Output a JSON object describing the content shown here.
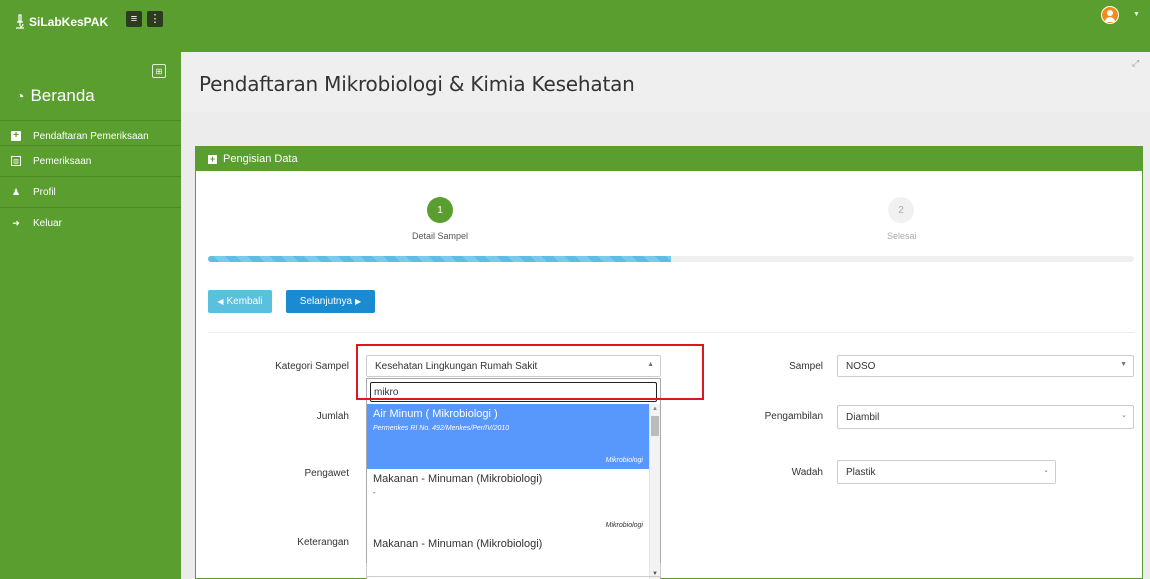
{
  "app": {
    "brand": "SiLabKesPAK"
  },
  "sidebar": {
    "home": "Beranda",
    "items": [
      {
        "label": "Pendaftaran Pemeriksaan",
        "icon": "plus-square-icon"
      },
      {
        "label": "Pemeriksaan",
        "icon": "grid-icon"
      },
      {
        "label": "Profil",
        "icon": "user-icon"
      },
      {
        "label": "Keluar",
        "icon": "sign-out-icon"
      }
    ]
  },
  "page": {
    "title": "Pendaftaran Mikrobiologi & Kimia Kesehatan"
  },
  "panel": {
    "title": "Pengisian Data"
  },
  "steps": [
    {
      "number": "1",
      "label": "Detail Sampel",
      "active": true
    },
    {
      "number": "2",
      "label": "Selesai",
      "active": false
    }
  ],
  "progress": {
    "fraction": 0.5
  },
  "buttons": {
    "back": "Kembali",
    "next": "Selanjutnya"
  },
  "form": {
    "kategori_label": "Kategori Sampel",
    "kategori_value": "Kesehatan Lingkungan Rumah Sakit",
    "jumlah_label": "Jumlah",
    "pengawet_label": "Pengawet",
    "keterangan_label": "Keterangan",
    "sampel_label": "Sampel",
    "sampel_value": "NOSO",
    "pengambilan_label": "Pengambilan",
    "pengambilan_value": "Diambil",
    "wadah_label": "Wadah",
    "wadah_value": "Plastik"
  },
  "dropdown": {
    "search_value": "mikro",
    "options": [
      {
        "title": "Air Minum ( Mikrobiologi )",
        "subtitle": "Permenkes RI No. 492/Menkes/Per/IV/2010",
        "category": "Mikrobiologi",
        "highlighted": true
      },
      {
        "title": "Makanan - Minuman (Mikrobiologi)",
        "subtitle": "-",
        "category": "Mikrobiologi",
        "highlighted": false
      },
      {
        "title": "Makanan - Minuman (Mikrobiologi)",
        "subtitle": "",
        "category": "",
        "highlighted": false
      }
    ]
  },
  "colors": {
    "brand_green": "#5a9e2f",
    "info": "#5bc0de",
    "primary": "#1a8bd0",
    "highlight": "#5897fb",
    "annotation_red": "#e0161e"
  }
}
